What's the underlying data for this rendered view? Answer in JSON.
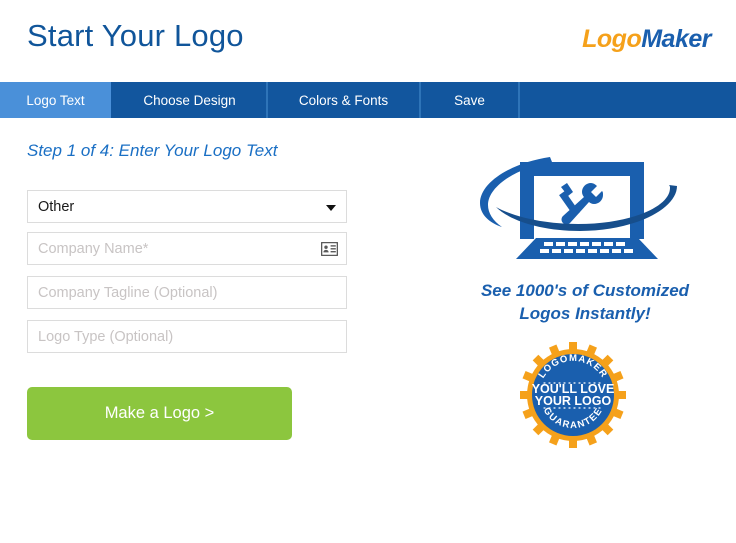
{
  "header": {
    "title": "Start Your Logo",
    "brand_first": "Logo",
    "brand_second": "Maker"
  },
  "nav": {
    "tabs": [
      {
        "label": "Logo Text",
        "active": true
      },
      {
        "label": "Choose Design",
        "active": false
      },
      {
        "label": "Colors & Fonts",
        "active": false
      },
      {
        "label": "Save",
        "active": false
      }
    ]
  },
  "form": {
    "step_heading": "Step 1 of 4: Enter Your Logo Text",
    "category_select": {
      "value": "Other",
      "icon": "chevron-down-icon"
    },
    "company_name": {
      "placeholder": "Company Name*",
      "value": "",
      "icon": "contact-card-icon"
    },
    "company_tagline": {
      "placeholder": "Company Tagline (Optional)",
      "value": ""
    },
    "logo_type": {
      "placeholder": "Logo Type  (Optional)",
      "value": ""
    },
    "submit_label": "Make a Logo >"
  },
  "promo": {
    "art_icon": "computer-tools-logo-icon",
    "headline_line1": "See 1000's of Customized",
    "headline_line2": "Logos Instantly!",
    "badge": {
      "arc_top": "LOGOMAKER",
      "center_line1": "YOU'LL LOVE",
      "center_line2": "YOUR LOGO",
      "arc_bottom": "GUARANTEE"
    }
  },
  "colors": {
    "brand_orange": "#F5A11B",
    "brand_blue": "#1A5FAE",
    "nav_blue": "#12569E",
    "active_tab_blue": "#4A90D9",
    "title_blue": "#10559A",
    "cta_green": "#8CC63E",
    "field_border": "#DCDCDC",
    "placeholder_gray": "#C8C4C4"
  }
}
